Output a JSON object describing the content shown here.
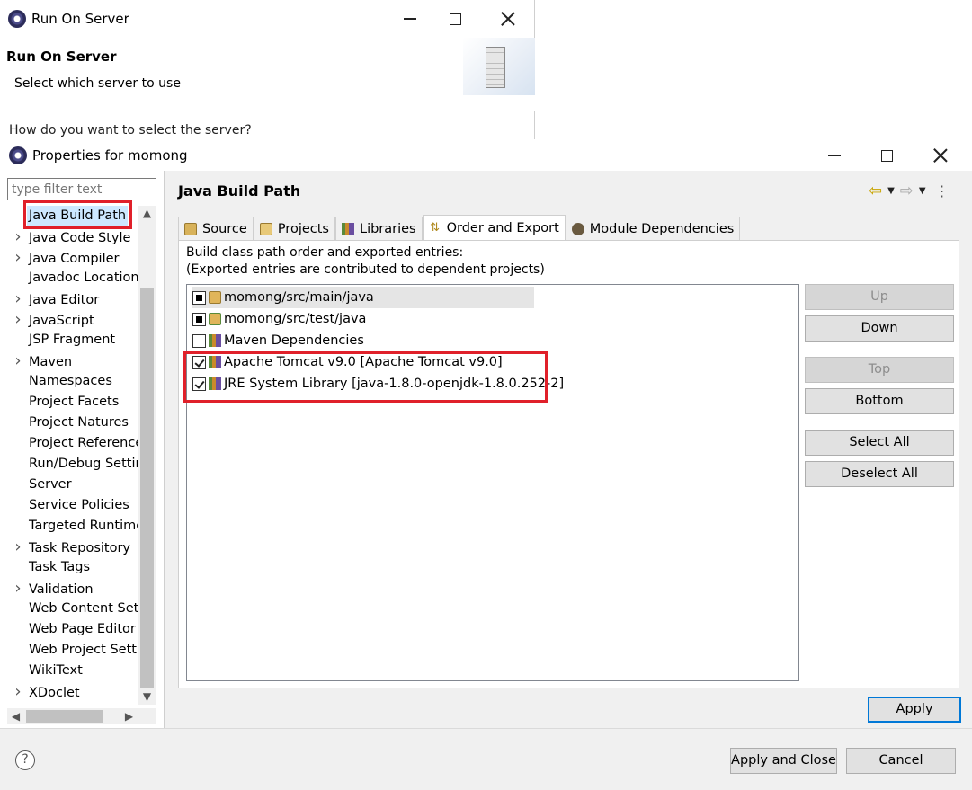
{
  "run_on_server": {
    "window_title": "Run On Server",
    "heading": "Run On Server",
    "subheading": "Select which server to use",
    "question": "How do you want to select the server?"
  },
  "properties": {
    "window_title": "Properties for momong",
    "filter_placeholder": "type filter text",
    "tree": [
      {
        "label": "Java Build Path",
        "expandable": false,
        "selected": true
      },
      {
        "label": "Java Code Style",
        "expandable": true
      },
      {
        "label": "Java Compiler",
        "expandable": true
      },
      {
        "label": "Javadoc Location",
        "expandable": false
      },
      {
        "label": "Java Editor",
        "expandable": true
      },
      {
        "label": "JavaScript",
        "expandable": true
      },
      {
        "label": "JSP Fragment",
        "expandable": false
      },
      {
        "label": "Maven",
        "expandable": true
      },
      {
        "label": "Namespaces",
        "expandable": false
      },
      {
        "label": "Project Facets",
        "expandable": false
      },
      {
        "label": "Project Natures",
        "expandable": false
      },
      {
        "label": "Project References",
        "expandable": false
      },
      {
        "label": "Run/Debug Settings",
        "expandable": false
      },
      {
        "label": "Server",
        "expandable": false
      },
      {
        "label": "Service Policies",
        "expandable": false
      },
      {
        "label": "Targeted Runtimes",
        "expandable": false
      },
      {
        "label": "Task Repository",
        "expandable": true
      },
      {
        "label": "Task Tags",
        "expandable": false
      },
      {
        "label": "Validation",
        "expandable": true
      },
      {
        "label": "Web Content Settings",
        "expandable": false
      },
      {
        "label": "Web Page Editor",
        "expandable": false
      },
      {
        "label": "Web Project Settings",
        "expandable": false
      },
      {
        "label": "WikiText",
        "expandable": false
      },
      {
        "label": "XDoclet",
        "expandable": true
      }
    ],
    "page_title": "Java Build Path",
    "tabs": [
      {
        "label": "Source",
        "icon": "source-folder-icon",
        "active": false
      },
      {
        "label": "Projects",
        "icon": "projects-icon",
        "active": false
      },
      {
        "label": "Libraries",
        "icon": "libraries-icon",
        "active": false
      },
      {
        "label": "Order and Export",
        "icon": "order-export-icon",
        "active": true
      },
      {
        "label": "Module Dependencies",
        "icon": "module-icon",
        "active": false
      }
    ],
    "description_line1": "Build class path order and exported entries:",
    "description_line2": "(Exported entries are contributed to dependent projects)",
    "entries": [
      {
        "label": "momong/src/main/java",
        "state": "partial",
        "icon": "source-folder-icon",
        "highlight": true
      },
      {
        "label": "momong/src/test/java",
        "state": "partial",
        "icon": "test-folder-icon",
        "highlight": false
      },
      {
        "label": "Maven Dependencies",
        "state": "unchecked",
        "icon": "library-icon",
        "highlight": false
      },
      {
        "label": "Apache Tomcat v9.0 [Apache Tomcat v9.0]",
        "state": "checked",
        "icon": "library-icon",
        "highlight": false
      },
      {
        "label": "JRE System Library [java-1.8.0-openjdk-1.8.0.252-2]",
        "state": "checked",
        "icon": "library-icon",
        "highlight": false
      }
    ],
    "side_buttons": {
      "up": "Up",
      "down": "Down",
      "top": "Top",
      "bottom": "Bottom",
      "select_all": "Select All",
      "deselect_all": "Deselect All"
    },
    "apply": "Apply",
    "apply_and_close": "Apply and Close",
    "cancel": "Cancel",
    "help_glyph": "?"
  },
  "colors": {
    "annotation_red": "#e0202a",
    "selection_blue": "#cde8ff",
    "default_button_border": "#0078d7"
  }
}
